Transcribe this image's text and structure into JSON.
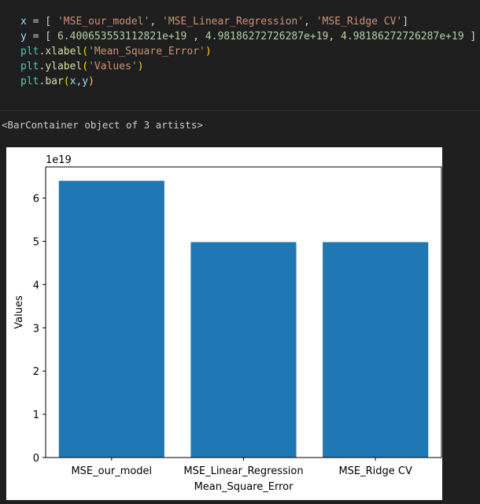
{
  "code_lines": {
    "line1": {
      "var": "x",
      "eq": " = [ ",
      "s1": "'MSE_our_model'",
      "c1": ", ",
      "s2": "'MSE_Linear_Regression'",
      "c2": ", ",
      "s3": "'MSE_Ridge CV'",
      "end": "]"
    },
    "line2": {
      "var": "y",
      "eq": " = [ ",
      "n1": "6.400653553112821e+19",
      "c1": " , ",
      "n2": "4.98186272726287e+19",
      "c2": ", ",
      "n3": "4.98186272726287e+19",
      "end": " ]"
    },
    "line3": {
      "mod": "plt",
      "dot": ".",
      "fn": "xlabel",
      "open": "(",
      "arg": "'Mean_Square_Error'",
      "close": ")"
    },
    "line4": {
      "mod": "plt",
      "dot": ".",
      "fn": "ylabel",
      "open": "(",
      "arg": "'Values'",
      "close": ")"
    },
    "line5": {
      "mod": "plt",
      "dot": ".",
      "fn": "bar",
      "open": "(",
      "arg": "x,y",
      "close": ")"
    }
  },
  "output": {
    "text": "<BarContainer object of 3 artists>"
  },
  "chart_data": {
    "type": "bar",
    "categories": [
      "MSE_our_model",
      "MSE_Linear_Regression",
      "MSE_Ridge CV"
    ],
    "values": [
      6.400653553112821e+19,
      4.98186272726287e+19,
      4.98186272726287e+19
    ],
    "title": "",
    "xlabel": "Mean_Square_Error",
    "ylabel": "Values",
    "ylim": [
      0,
      6.72e+19
    ],
    "yticks": [
      0,
      1,
      2,
      3,
      4,
      5,
      6
    ],
    "ytick_labels": [
      "0",
      "1",
      "2",
      "3",
      "4",
      "5",
      "6"
    ],
    "y_offset_label": "1e19",
    "bar_color": "#1f77b4",
    "grid": false,
    "legend": "none"
  }
}
